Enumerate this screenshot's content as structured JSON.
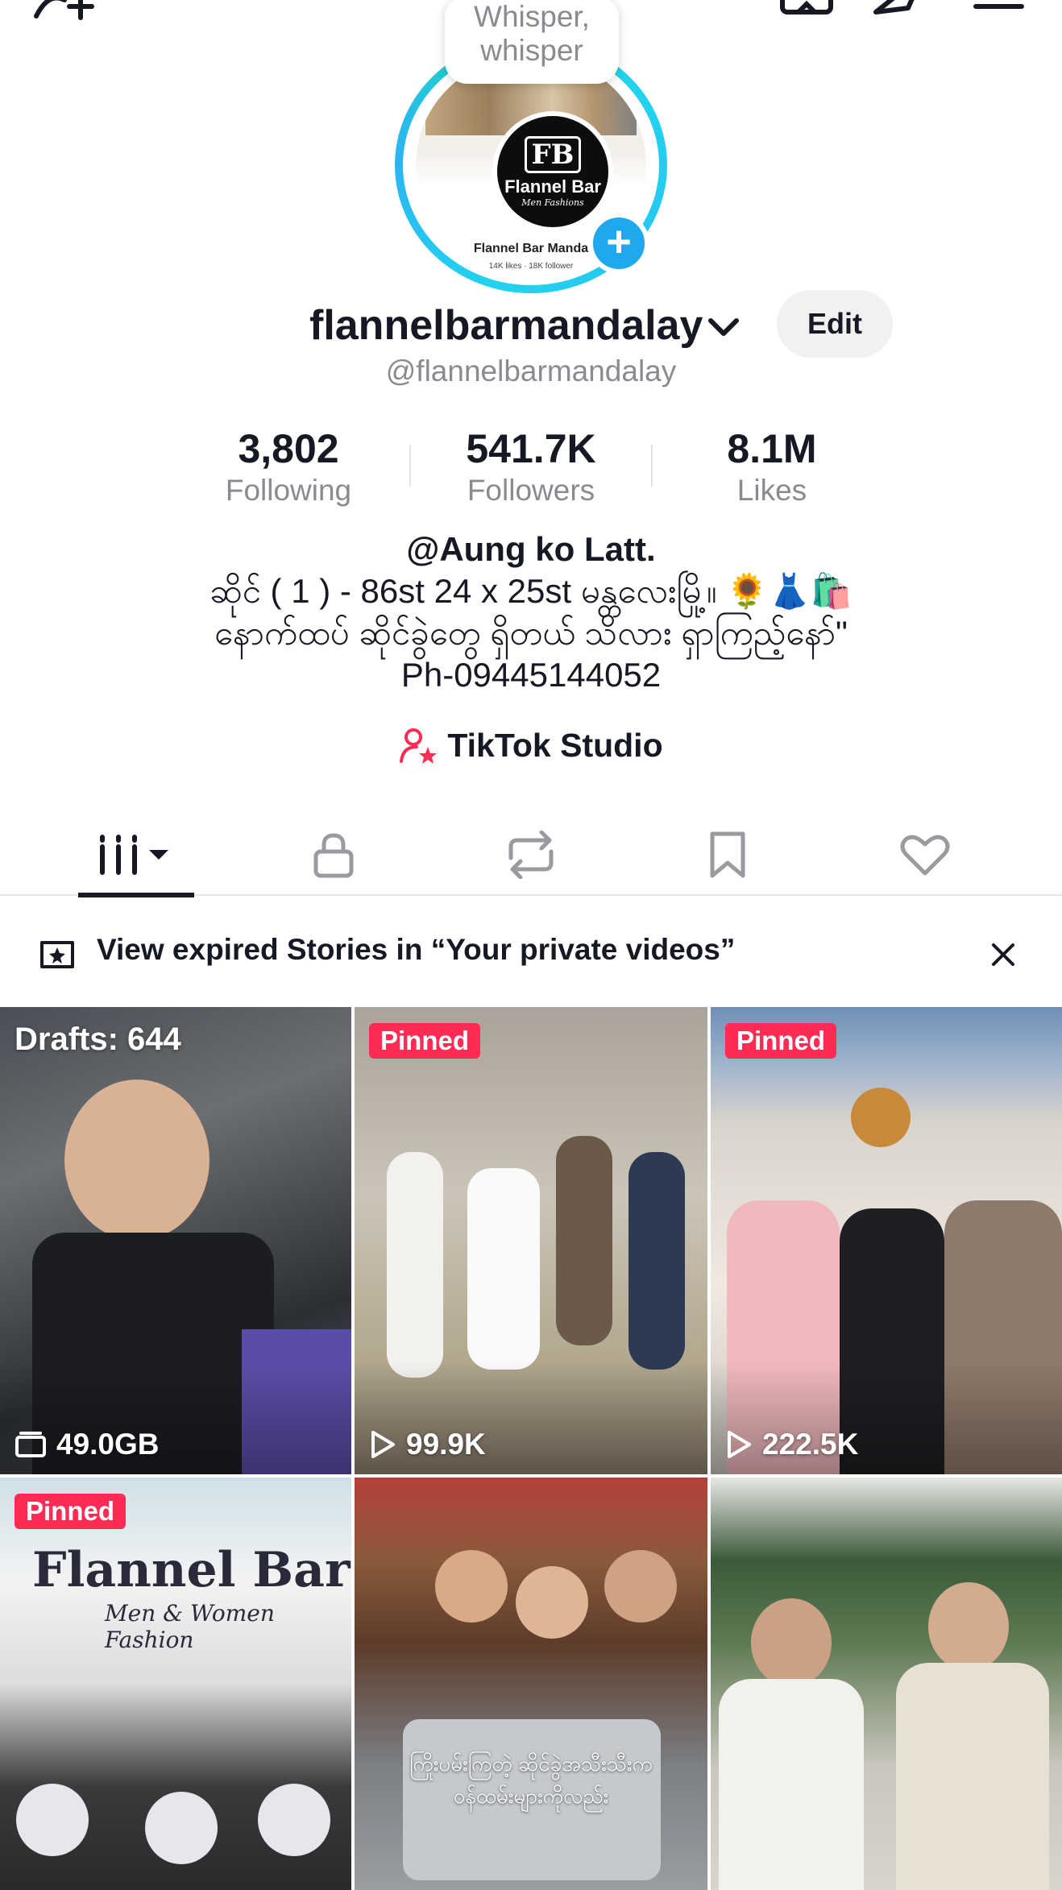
{
  "colors": {
    "accent_pink": "#fe2c55",
    "ring_cyan": "#22d3ee",
    "add_blue": "#20a8ef",
    "text_primary": "#161823",
    "text_secondary": "#8a8b91"
  },
  "header": {
    "icons": [
      "add-friend-icon",
      "qr-icon",
      "share-icon",
      "menu-icon"
    ]
  },
  "avatar": {
    "bubble_text": "Whisper, whisper",
    "bubble_line1": "Whisper,",
    "bubble_line2": "whisper",
    "thumb_logo_mark": "FB",
    "thumb_logo_name": "Flannel Bar",
    "thumb_logo_sub": "Men Fashions",
    "thumb_name": "Flannel Bar Manda",
    "thumb_stats": "14K likes · 18K follower"
  },
  "profile": {
    "username": "flannelbarmandalay",
    "handle": "@flannelbarmandalay",
    "edit_label": "Edit"
  },
  "stats": [
    {
      "value": "3,802",
      "label": "Following"
    },
    {
      "value": "541.7K",
      "label": "Followers"
    },
    {
      "value": "8.1M",
      "label": "Likes"
    }
  ],
  "bio": {
    "mention": "@Aung ko Latt.",
    "line2": "ဆိုင် ( 1 ) - 86st 24 x 25st မန္တလေးမြို့။ 🌻👗🛍️",
    "line3": "နောက်ထပ် ဆိုင်ခွဲတွေ ရှိတယ် သိလား ရှာကြည့်နော်\"",
    "line4": "Ph-09445144052"
  },
  "studio": {
    "label": "TikTok Studio"
  },
  "tabs": [
    {
      "name": "videos",
      "icon": "grid-bars-icon"
    },
    {
      "name": "private",
      "icon": "lock-icon"
    },
    {
      "name": "reposts",
      "icon": "repost-icon"
    },
    {
      "name": "favorites",
      "icon": "bookmark-icon"
    },
    {
      "name": "liked",
      "icon": "heart-icon"
    }
  ],
  "banner": {
    "text": "View expired Stories in “Your private videos”"
  },
  "grid": {
    "pinned_label": "Pinned",
    "items": [
      {
        "drafts": "Drafts: 644",
        "meta": "49.0GB"
      },
      {
        "pinned": true,
        "meta": "99.9K"
      },
      {
        "pinned": true,
        "meta": "222.5K"
      },
      {
        "pinned": true,
        "storefront": "Flannel Bar",
        "storefront_sub": "Men & Women Fashion"
      },
      {
        "caption1": "ကြိုးပမ်းကြတဲ့ ဆိုင်ခွဲအသီးသီးက",
        "caption2": "ဝန်ထမ်းများကိုလည်း"
      },
      {}
    ]
  }
}
